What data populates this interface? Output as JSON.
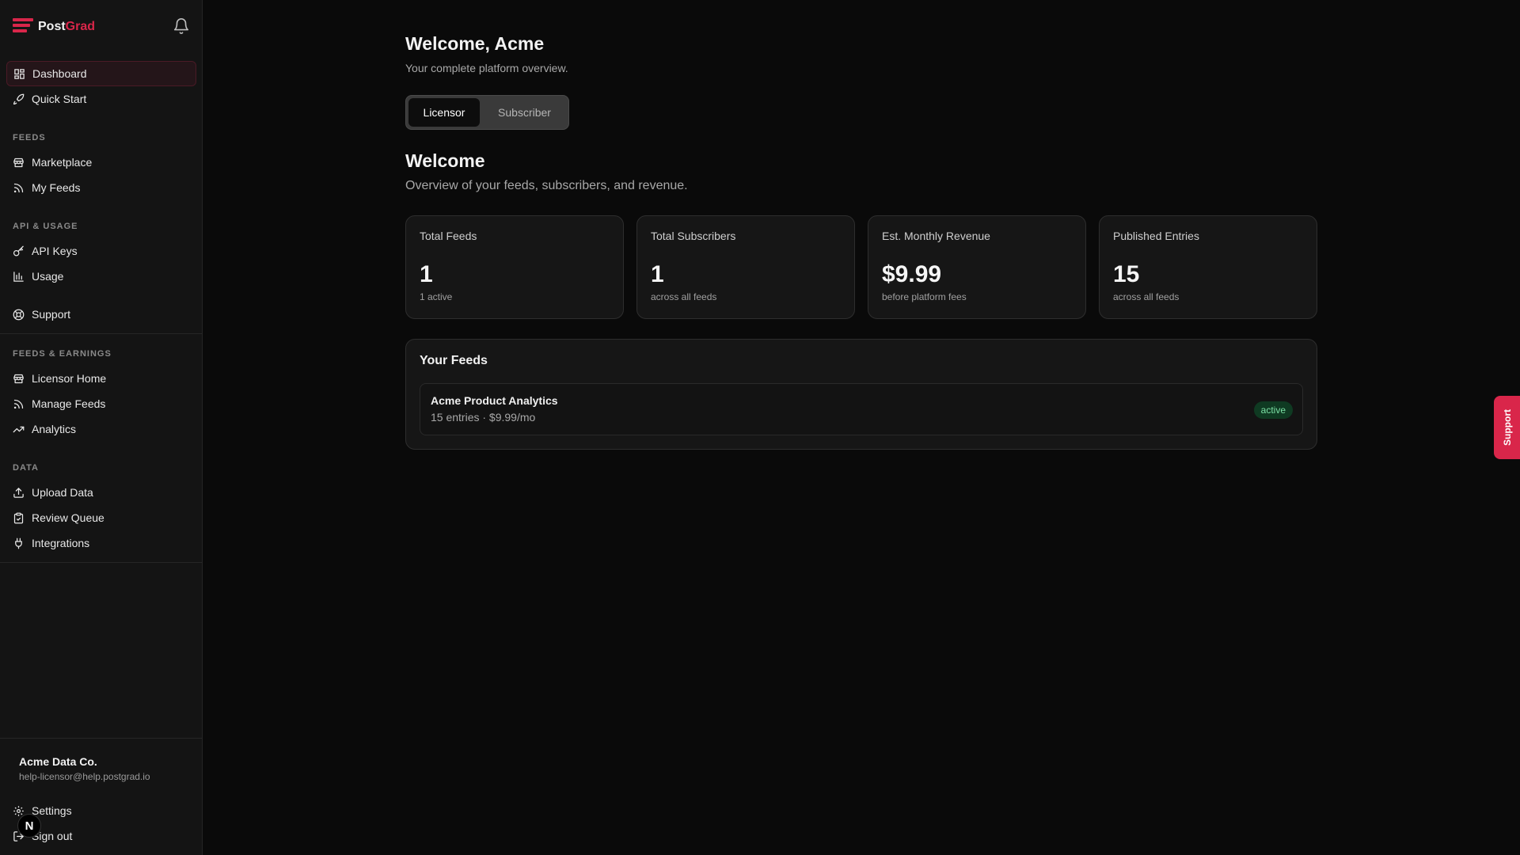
{
  "brand": {
    "name_part1": "Post",
    "name_part2": "Grad",
    "accent": "#d9264a"
  },
  "sidebar": {
    "top_items": [
      {
        "label": "Dashboard",
        "icon": "grid-icon",
        "active": true
      },
      {
        "label": "Quick Start",
        "icon": "rocket-icon"
      }
    ],
    "sections": [
      {
        "label": "FEEDS",
        "items": [
          {
            "label": "Marketplace",
            "icon": "store-icon"
          },
          {
            "label": "My Feeds",
            "icon": "rss-icon"
          }
        ]
      },
      {
        "label": "API & USAGE",
        "items": [
          {
            "label": "API Keys",
            "icon": "key-icon"
          },
          {
            "label": "Usage",
            "icon": "bar-chart-icon"
          }
        ]
      },
      {
        "label": "",
        "items": [
          {
            "label": "Support",
            "icon": "lifebuoy-icon"
          }
        ]
      },
      {
        "label": "FEEDS & EARNINGS",
        "items": [
          {
            "label": "Licensor Home",
            "icon": "store-icon"
          },
          {
            "label": "Manage Feeds",
            "icon": "rss-icon"
          },
          {
            "label": "Analytics",
            "icon": "trending-up-icon"
          }
        ]
      },
      {
        "label": "DATA",
        "items": [
          {
            "label": "Upload Data",
            "icon": "upload-icon"
          },
          {
            "label": "Review Queue",
            "icon": "clipboard-check-icon"
          },
          {
            "label": "Integrations",
            "icon": "plug-icon"
          }
        ]
      }
    ],
    "account": {
      "name": "Acme Data Co.",
      "email": "help-licensor@help.postgrad.io"
    },
    "bottom_items": [
      {
        "label": "Settings",
        "icon": "gear-icon"
      },
      {
        "label": "Sign out",
        "icon": "sign-out-icon"
      }
    ],
    "avatar_letter": "N"
  },
  "main": {
    "welcome_title": "Welcome, Acme",
    "welcome_subtitle": "Your complete platform overview.",
    "toggle": {
      "options": [
        "Licensor",
        "Subscriber"
      ],
      "selected": "Licensor"
    },
    "section_title": "Welcome",
    "section_subtitle": "Overview of your feeds, subscribers, and revenue.",
    "stats": [
      {
        "label": "Total Feeds",
        "value": "1",
        "note": "1 active"
      },
      {
        "label": "Total Subscribers",
        "value": "1",
        "note": "across all feeds"
      },
      {
        "label": "Est. Monthly Revenue",
        "value": "$9.99",
        "note": "before platform fees"
      },
      {
        "label": "Published Entries",
        "value": "15",
        "note": "across all feeds"
      }
    ],
    "feeds_panel": {
      "title": "Your Feeds",
      "feeds": [
        {
          "name": "Acme Product Analytics",
          "meta": "15 entries · $9.99/mo",
          "status": "active"
        }
      ]
    }
  },
  "support_tab": {
    "label": "Support"
  }
}
